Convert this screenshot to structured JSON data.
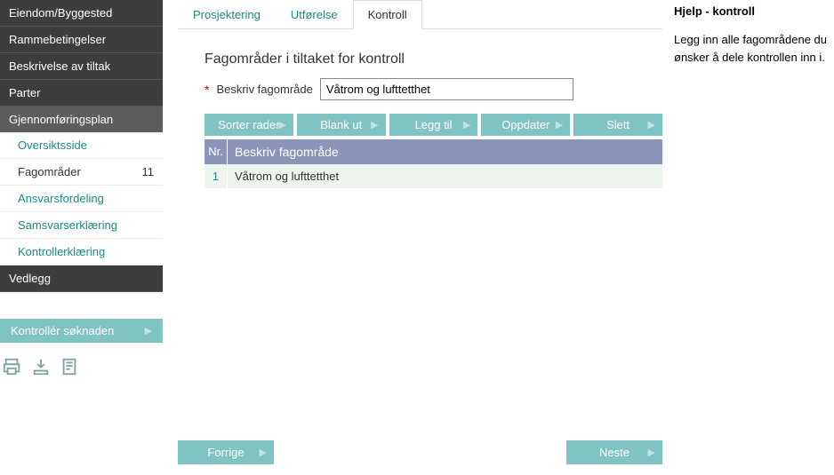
{
  "sidebar": {
    "items": [
      {
        "label": "Eiendom/Byggested",
        "type": "dark"
      },
      {
        "label": "Rammebetingelser",
        "type": "dark"
      },
      {
        "label": "Beskrivelse av tiltak",
        "type": "dark"
      },
      {
        "label": "Parter",
        "type": "dark"
      },
      {
        "label": "Gjennomføringsplan",
        "type": "head"
      },
      {
        "label": "Oversiktsside",
        "type": "light"
      },
      {
        "label": "Fagområder",
        "type": "light-active",
        "badge": "11"
      },
      {
        "label": "Ansvarsfordeling",
        "type": "light"
      },
      {
        "label": "Samsvarserklæring",
        "type": "light"
      },
      {
        "label": "Kontrollerklæring",
        "type": "light"
      },
      {
        "label": "Vedlegg",
        "type": "dark"
      }
    ],
    "check_btn": "Kontrollér søknaden"
  },
  "tabs": [
    {
      "label": "Prosjektering",
      "active": false
    },
    {
      "label": "Utførelse",
      "active": false
    },
    {
      "label": "Kontroll",
      "active": true
    }
  ],
  "heading": "Fagområder i tiltaket for kontroll",
  "form": {
    "label": "Beskriv fagområde",
    "value": "Våtrom og lufttetthet"
  },
  "actions": [
    "Sorter rader",
    "Blank ut",
    "Legg til",
    "Oppdater",
    "Slett"
  ],
  "table": {
    "headers": {
      "nr": "Nr.",
      "desc": "Beskriv fagområde"
    },
    "rows": [
      {
        "nr": "1",
        "desc": "Våtrom og lufttetthet"
      }
    ]
  },
  "footer": {
    "prev": "Forrige",
    "next": "Neste"
  },
  "help": {
    "title": "Hjelp - kontroll",
    "text": "Legg inn alle fagområdene du ønsker å dele kontrollen inn i."
  }
}
